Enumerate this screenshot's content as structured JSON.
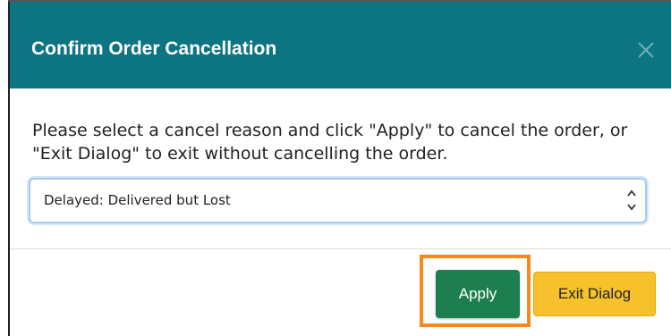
{
  "dialog": {
    "title": "Confirm Order Cancellation",
    "close_icon": "close-icon",
    "message": "Please select a cancel reason and click \"Apply\" to cancel the order, or \"Exit Dialog\" to exit without cancelling the order.",
    "cancel_reason": {
      "selected_value": "Delayed: Delivered but Lost",
      "arrow_icon": "up-down-arrows-icon"
    },
    "buttons": {
      "apply_label": "Apply",
      "exit_label": "Exit Dialog"
    }
  },
  "colors": {
    "header_bg": "#0d7481",
    "apply_bg": "#1d7f4f",
    "exit_bg": "#f6c12a",
    "highlight_border": "#f48a1a"
  }
}
